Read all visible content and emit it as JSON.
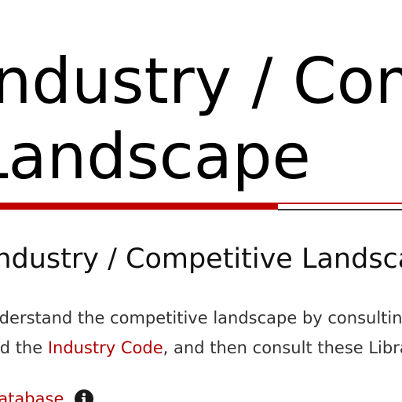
{
  "page": {
    "title_line1": "Industry / Competitive",
    "title_line2": "Landscape"
  },
  "box": {
    "heading": "Industry / Competitive Landscape",
    "text_line1": "Understand the competitive landscape by consulting published",
    "text_line2_prefix": "Find the ",
    "text_line2_link": "Industry Code",
    "text_line2_suffix": ", and then consult these Library resources."
  },
  "bottom": {
    "link_text": "database",
    "info_icon": "info-circle-icon"
  },
  "colors": {
    "accent": "#c00000",
    "link": "#b00000",
    "text": "#333333"
  }
}
